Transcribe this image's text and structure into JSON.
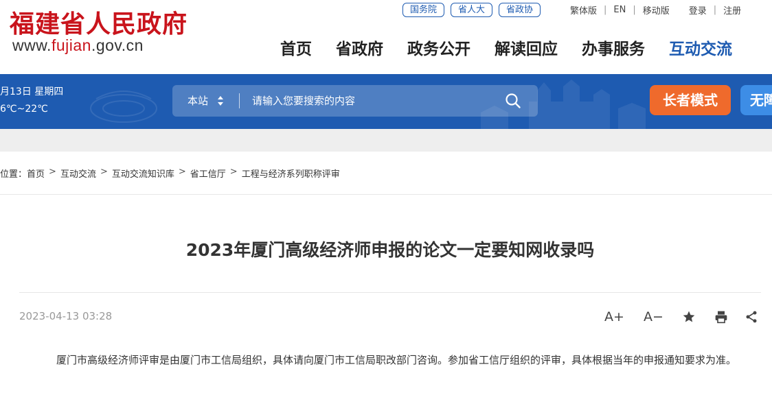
{
  "header": {
    "site_name": "福建省人民政府",
    "url_prefix": "www.",
    "url_highlight": "fujian",
    "url_suffix": ".gov.cn",
    "top_pills": [
      "国务院",
      "省人大",
      "省政协"
    ],
    "lang_links": [
      "繁体版",
      "EN",
      "移动版"
    ],
    "auth_links": [
      "登录",
      "注册"
    ]
  },
  "nav": {
    "items": [
      "首页",
      "省政府",
      "政务公开",
      "解读回应",
      "办事服务",
      "互动交流"
    ],
    "active": "互动交流"
  },
  "banner": {
    "date": "月13日 星期四",
    "temperature": "6℃~22℃",
    "search_scope": "本站",
    "search_placeholder": "请输入您要搜索的内容",
    "elder_mode": "长者模式",
    "accessibility": "无障"
  },
  "breadcrumb": {
    "prefix": "位置：",
    "items": [
      "首页",
      "互动交流",
      "互动交流知识库",
      "省工信厅",
      "工程与经济系列职称评审"
    ],
    "separator": ">"
  },
  "article": {
    "title": "2023年厦门高级经济师申报的论文一定要知网收录吗",
    "date": "2023-04-13 03:28",
    "tools": {
      "font_larger": "A+",
      "font_smaller": "A−"
    },
    "body": "厦门市高级经济师评审是由厦门市工信局组织，具体请向厦门市工信局职改部门咨询。参加省工信厅组织的评审，具体根据当年的申报通知要求为准。"
  },
  "colors": {
    "brand_red": "#c9141c",
    "brand_blue": "#1e5bb1",
    "elder_orange": "#ef6a2c",
    "access_blue": "#3d8de6"
  },
  "icons": [
    "sort-arrows-icon",
    "search-icon",
    "star-icon",
    "print-icon",
    "share-icon"
  ]
}
